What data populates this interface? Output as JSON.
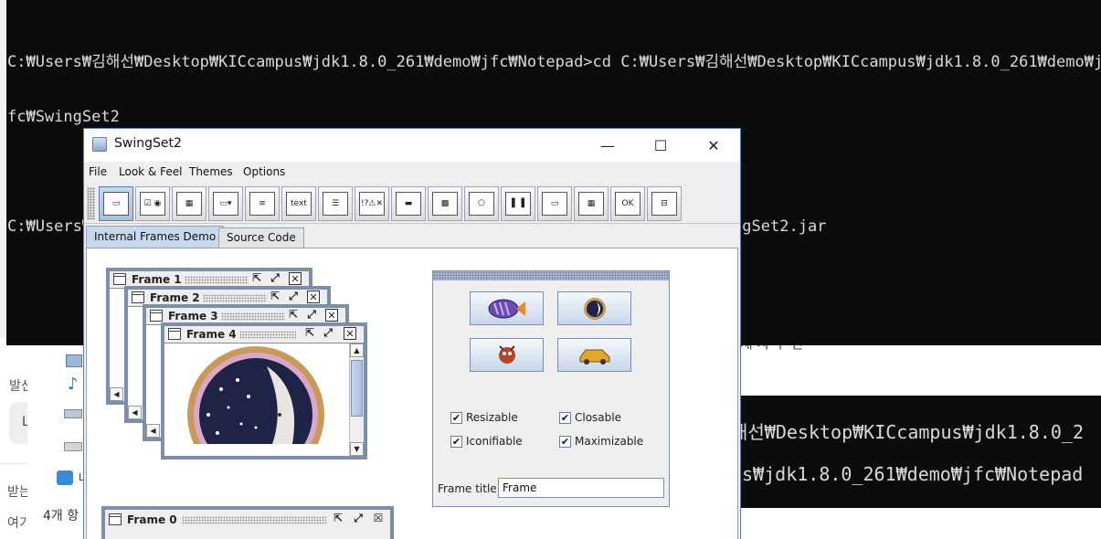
{
  "console": {
    "line1": "C:₩Users₩김해선₩Desktop₩KICcampus₩jdk1.8.0_261₩demo₩jfc₩Notepad>cd C:₩Users₩김해선₩Desktop₩KICcampus₩jdk1.8.0_261₩demo₩jfc₩SwingSet2",
    "line1a": "C:₩Users₩김해선₩Desktop₩KICcampus₩jdk1.8.0_261₩demo₩jfc₩Notepad>cd C:₩Users₩김해선₩Desktop₩KICcampus₩jdk1.8.0_261₩demo₩j",
    "line1b": "fc₩SwingSet2",
    "line2": "C:₩Users₩김해선₩Desktop₩KICcampus₩jdk1.8.0_261₩demo₩jfc₩SwingSet2>java -jar SwingSet2.jar"
  },
  "console_right": {
    "line1": "해선₩Desktop₩KICcampus₩jdk1.8.0_2",
    "line2": "us₩jdk1.8.0_261₩demo₩jfc₩Notepad"
  },
  "background": {
    "label_send": "발신",
    "label_recv": "받는",
    "label_here": "여기",
    "input_letter": "L",
    "faded_text": "제 사 수 단",
    "explorer_count": "4개 항"
  },
  "window": {
    "title": "SwingSet2",
    "minimize": "—",
    "maximize": "☐",
    "close": "✕"
  },
  "menu": {
    "file": "File",
    "look_feel": "Look & Feel",
    "themes": "Themes",
    "options": "Options"
  },
  "toolbar": {
    "tools": [
      {
        "name": "internal-frames",
        "glyph": "▭"
      },
      {
        "name": "buttons",
        "glyph": "☑ ◉"
      },
      {
        "name": "color-chooser",
        "glyph": "▦"
      },
      {
        "name": "combobox",
        "glyph": "▭▾"
      },
      {
        "name": "file-chooser",
        "glyph": "≡"
      },
      {
        "name": "html",
        "glyph": "text"
      },
      {
        "name": "list",
        "glyph": "☰"
      },
      {
        "name": "option-pane",
        "glyph": "!?⚠✕"
      },
      {
        "name": "progress-bar",
        "glyph": "▬"
      },
      {
        "name": "scroll-pane",
        "glyph": "▩"
      },
      {
        "name": "slider",
        "glyph": "⬠"
      },
      {
        "name": "split-pane",
        "glyph": "▌▐"
      },
      {
        "name": "tabbed-pane",
        "glyph": "▭"
      },
      {
        "name": "table",
        "glyph": "▦"
      },
      {
        "name": "tooltip",
        "glyph": "OK"
      },
      {
        "name": "tree",
        "glyph": "⊟"
      }
    ]
  },
  "tabs": {
    "demo": "Internal Frames Demo",
    "source": "Source Code"
  },
  "frames": {
    "f1": "Frame 1",
    "f2": "Frame 2",
    "f3": "Frame 3",
    "f4": "Frame 4",
    "f0": "Frame 0"
  },
  "controls": {
    "resizable": "Resizable",
    "closable": "Closable",
    "iconifiable": "Iconifiable",
    "maximizable": "Maximizable",
    "check_mark": "✔",
    "frame_title_label": "Frame title:",
    "frame_title_value": "Frame"
  },
  "colors": {
    "console_bg": "#0c0c0c",
    "swing_accent": "#7d8ea8",
    "selected_tab": "#c8d8ee"
  }
}
